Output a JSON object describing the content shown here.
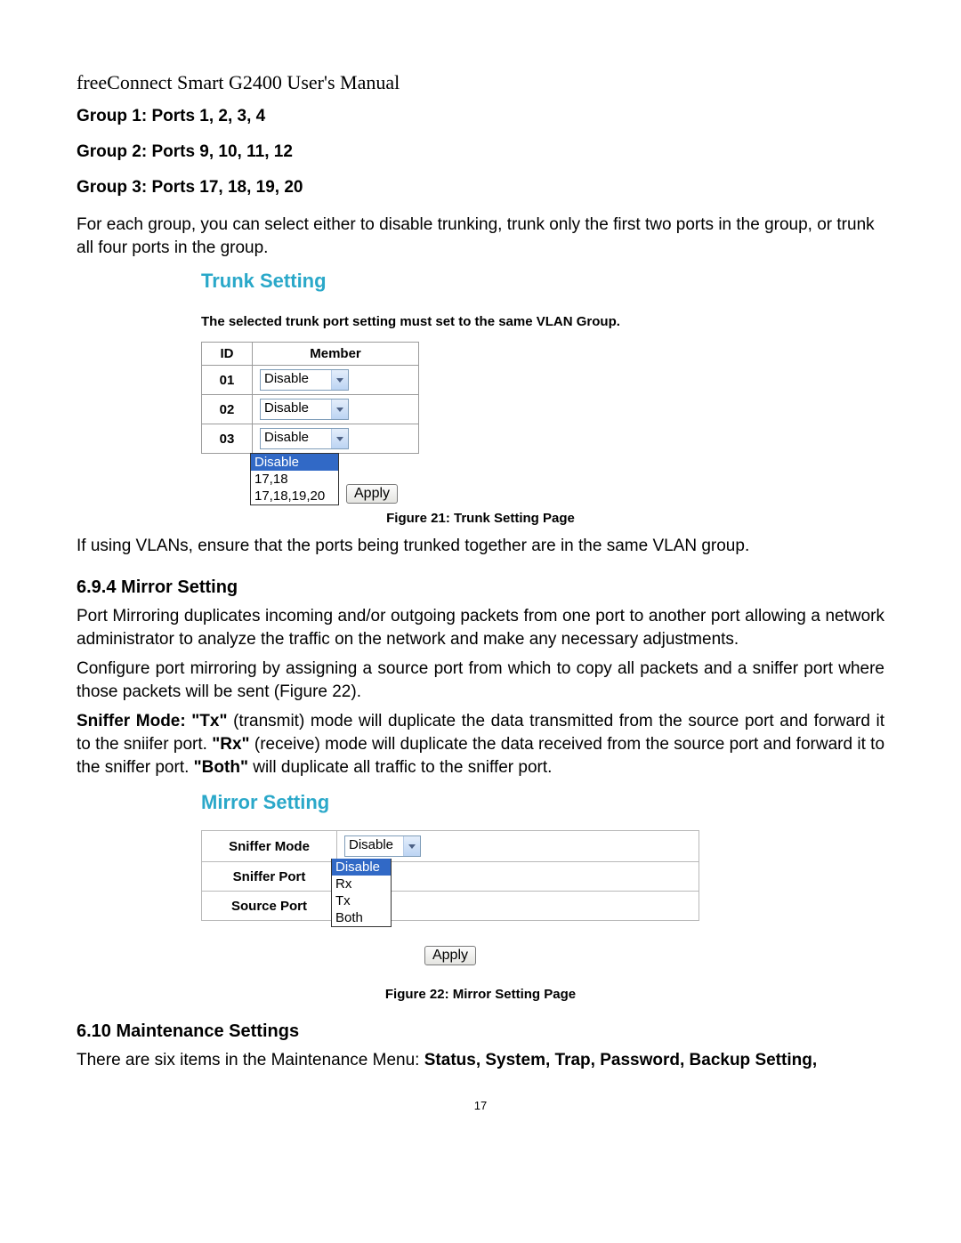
{
  "header": "freeConnect Smart G2400 User's Manual",
  "groups": {
    "g1": "Group 1: Ports 1, 2, 3, 4",
    "g2": "Group 2: Ports 9, 10, 11, 12",
    "g3": "Group 3: Ports 17, 18, 19, 20"
  },
  "p_trunk_intro": "For each group, you can select either to disable trunking, trunk only the first two ports in the group, or trunk all four ports in the group.",
  "trunk_fig": {
    "title": "Trunk Setting",
    "note": "The selected trunk port setting must set to the same VLAN Group.",
    "th_id": "ID",
    "th_member": "Member",
    "rows": [
      {
        "id": "01",
        "value": "Disable"
      },
      {
        "id": "02",
        "value": "Disable"
      },
      {
        "id": "03",
        "value": "Disable"
      }
    ],
    "dropdown_options": {
      "o1": "Disable",
      "o2": "17,18",
      "o3": "17,18,19,20"
    },
    "apply": "Apply",
    "caption": "Figure 21: Trunk Setting Page"
  },
  "p_vlan_note": "If using VLANs, ensure that the ports being trunked together are in the same VLAN group.",
  "sec_mirror_heading": "6.9.4   Mirror Setting",
  "p_mirror_1": "Port Mirroring duplicates incoming and/or outgoing packets from one port to another port allowing a network administrator to analyze the traffic on the network and make any necessary adjustments.",
  "p_mirror_2": "Configure port mirroring by assigning a source port from which to copy all packets and a sniffer port where those packets will be sent (Figure 22).",
  "p_mirror_3_parts": {
    "a": "Sniffer Mode: \"Tx\"",
    "b": " (transmit) mode will duplicate the data transmitted from the source port and forward it to the sniifer port.  ",
    "c": "\"Rx\"",
    "d": " (receive) mode will duplicate the data received from the source port and forward it to the sniffer port.  ",
    "e": "\"Both\"",
    "f": " will duplicate all traffic to the sniffer port."
  },
  "mirror_fig": {
    "title": "Mirror Setting",
    "row1_label": "Sniffer Mode",
    "row1_value": "Disable",
    "row2_label": "Sniffer Port",
    "row3_label": "Source Port",
    "dropdown_options": {
      "o1": "Disable",
      "o2": "Rx",
      "o3": "Tx",
      "o4": "Both"
    },
    "apply": "Apply",
    "caption": "Figure 22: Mirror Setting Page"
  },
  "sec_maint_heading": "6.10  Maintenance Settings",
  "p_maint_parts": {
    "a": "There are six items in the Maintenance Menu: ",
    "b": "Status, System, Trap, Password, Backup Setting,"
  },
  "page_number": "17"
}
